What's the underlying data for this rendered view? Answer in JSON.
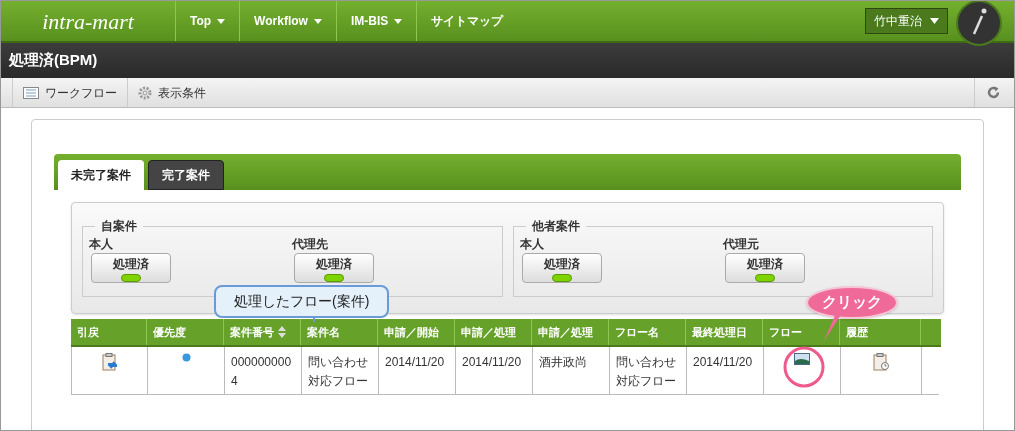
{
  "header": {
    "logo": "intra-mart",
    "nav": [
      "Top",
      "Workflow",
      "IM-BIS",
      "サイトマップ"
    ],
    "nav_dropdown": [
      true,
      true,
      true,
      false
    ],
    "user": "竹中重治"
  },
  "page_title": "処理済(BPM)",
  "toolbar": [
    {
      "label": "ワークフロー",
      "kind": "list"
    },
    {
      "label": "表示条件",
      "kind": "gear"
    }
  ],
  "tabs": [
    {
      "label": "未完了案件",
      "selected": true
    },
    {
      "label": "完了案件",
      "selected": false
    }
  ],
  "groups": [
    {
      "legend": "自案件",
      "items": [
        {
          "label": "本人",
          "button": "処理済"
        },
        {
          "label": "代理先",
          "button": "処理済"
        }
      ]
    },
    {
      "legend": "他者案件",
      "items": [
        {
          "label": "本人",
          "button": "処理済"
        },
        {
          "label": "代理元",
          "button": "処理済"
        }
      ]
    }
  ],
  "table": {
    "columns": [
      {
        "label": "引戻",
        "sorted": false
      },
      {
        "label": "優先度",
        "sorted": false
      },
      {
        "label": "案件番号",
        "sorted": true
      },
      {
        "label": "案件名",
        "sorted": false
      },
      {
        "label": "申請／開始",
        "sorted": false
      },
      {
        "label": "申請／処理",
        "sorted": false
      },
      {
        "label": "申請／処理",
        "sorted": false
      },
      {
        "label": "フロー名",
        "sorted": false
      },
      {
        "label": "最終処理日",
        "sorted": false
      },
      {
        "label": "フロー",
        "sorted": false
      },
      {
        "label": "履歴",
        "sorted": false
      }
    ],
    "rows": [
      {
        "cells": [
          "",
          "",
          "0000000004",
          "問い合わせ対応フロー",
          "2014/11/20",
          "2014/11/20",
          "酒井政尚",
          "問い合わせ対応フロー",
          "2014/11/20",
          "",
          ""
        ]
      }
    ]
  },
  "annotations": [
    {
      "kind": "note",
      "text": "処理したフロー(案件)"
    },
    {
      "kind": "click",
      "text": "クリック"
    }
  ]
}
